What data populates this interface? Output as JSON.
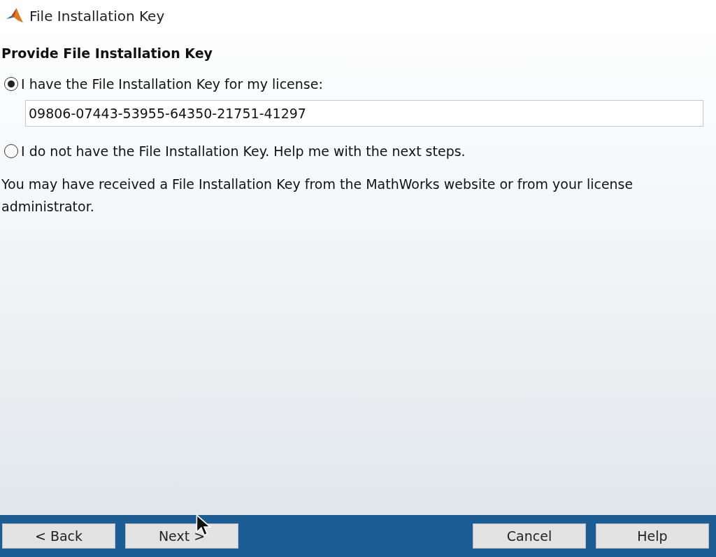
{
  "window": {
    "title": "File Installation Key"
  },
  "heading": "Provide File Installation Key",
  "options": [
    {
      "label": "I have the File Installation Key for my license:",
      "selected": true
    },
    {
      "label": "I do not have the File Installation Key.  Help me with the next steps.",
      "selected": false
    }
  ],
  "key_field": {
    "value": "09806-07443-53955-64350-21751-41297"
  },
  "note": "You may have received a File Installation Key from the MathWorks website or from your license administrator.",
  "buttons": [
    {
      "label": "< Back",
      "kind": "back"
    },
    {
      "label": "Next >",
      "kind": "next"
    },
    {
      "label": "Cancel",
      "kind": "cancel"
    },
    {
      "label": "Help",
      "kind": "help"
    }
  ]
}
